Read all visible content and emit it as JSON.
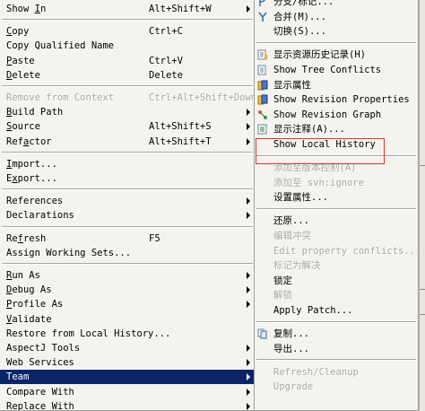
{
  "left_menu": [
    {
      "label": "Show In",
      "accel": "Alt+Shift+W",
      "arrow": true,
      "u": 5
    },
    {
      "sep": true
    },
    {
      "label": "Copy",
      "accel": "Ctrl+C",
      "u": 0
    },
    {
      "label": "Copy Qualified Name"
    },
    {
      "label": "Paste",
      "accel": "Ctrl+V",
      "u": 0
    },
    {
      "label": "Delete",
      "accel": "Delete",
      "u": 0
    },
    {
      "sep": true
    },
    {
      "label": "Remove from Context",
      "accel": "Ctrl+Alt+Shift+Down",
      "disabled": true
    },
    {
      "label": "Build Path",
      "arrow": true,
      "u": 0
    },
    {
      "label": "Source",
      "accel": "Alt+Shift+S",
      "arrow": true,
      "u": 0
    },
    {
      "label": "Refactor",
      "accel": "Alt+Shift+T",
      "arrow": true,
      "u": 3
    },
    {
      "sep": true
    },
    {
      "label": "Import...",
      "arrow": false,
      "u": 0
    },
    {
      "label": "Export...",
      "u": 1
    },
    {
      "sep": true
    },
    {
      "label": "References",
      "arrow": true
    },
    {
      "label": "Declarations",
      "arrow": true
    },
    {
      "sep": true
    },
    {
      "label": "Refresh",
      "accel": "F5",
      "u": 2
    },
    {
      "label": "Assign Working Sets..."
    },
    {
      "sep": true
    },
    {
      "label": "Run As",
      "arrow": true,
      "u": 0
    },
    {
      "label": "Debug As",
      "arrow": true,
      "u": 0
    },
    {
      "label": "Profile As",
      "arrow": true,
      "u": 0
    },
    {
      "label": "Validate",
      "u": 0
    },
    {
      "label": "Restore from Local History..."
    },
    {
      "label": "AspectJ Tools",
      "arrow": true
    },
    {
      "label": "Web Services",
      "arrow": true
    },
    {
      "label": "Team",
      "arrow": true,
      "selected": true
    },
    {
      "label": "Compare With",
      "arrow": true
    },
    {
      "label": "Replace With",
      "arrow": true
    }
  ],
  "right_menu": [
    {
      "label": "分支/标记...",
      "icon": "branch-icon"
    },
    {
      "label": "合并(M)...",
      "icon": "merge-icon"
    },
    {
      "label": "切换(S)...",
      "icon": ""
    },
    {
      "sep": true
    },
    {
      "label": "显示资源历史记录(H)",
      "icon": "history-icon"
    },
    {
      "label": "Show Tree Conflicts",
      "icon": "conflict-icon"
    },
    {
      "label": "显示属性",
      "icon": "properties-icon"
    },
    {
      "label": "Show Revision Properties",
      "icon": "revision-properties-icon"
    },
    {
      "label": "Show Revision Graph",
      "icon": "revision-graph-icon"
    },
    {
      "label": "显示注释(A)...",
      "icon": "annotate-icon"
    },
    {
      "label": "Show Local History",
      "icon": ""
    },
    {
      "sep": true
    },
    {
      "label": "添加至版本控制(A)",
      "disabled": true
    },
    {
      "label": "添加至 svn:ignore",
      "disabled": true
    },
    {
      "label": "设置属性..."
    },
    {
      "sep": true
    },
    {
      "label": "还原..."
    },
    {
      "label": "编辑冲突",
      "disabled": true
    },
    {
      "label": "Edit property conflicts...",
      "disabled": true
    },
    {
      "label": "标记为解决",
      "disabled": true
    },
    {
      "label": "锁定"
    },
    {
      "label": "解锁",
      "disabled": true
    },
    {
      "label": "Apply Patch..."
    },
    {
      "sep": true
    },
    {
      "label": "复制...",
      "icon": "copy-icon"
    },
    {
      "label": "导出..."
    },
    {
      "sep": true
    },
    {
      "label": "Refresh/Cleanup",
      "disabled": true
    },
    {
      "label": "Upgrade",
      "disabled": true
    }
  ]
}
